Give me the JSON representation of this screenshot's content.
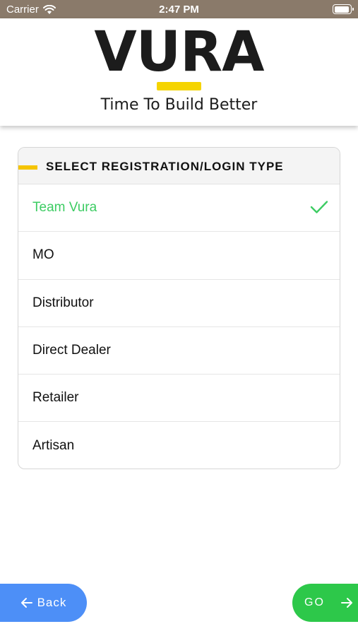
{
  "status_bar": {
    "carrier": "Carrier",
    "time": "2:47 PM"
  },
  "brand": {
    "logo_text": "VURA",
    "tagline": "Time To Build Better",
    "accent_color": "#f5d400"
  },
  "selection": {
    "title": "SELECT REGISTRATION/LOGIN TYPE",
    "options": [
      {
        "label": "Team Vura",
        "selected": true
      },
      {
        "label": "MO",
        "selected": false
      },
      {
        "label": "Distributor",
        "selected": false
      },
      {
        "label": "Direct Dealer",
        "selected": false
      },
      {
        "label": "Retailer",
        "selected": false
      },
      {
        "label": "Artisan",
        "selected": false
      }
    ],
    "selected_color": "#3dcc63"
  },
  "actions": {
    "back_label": "Back",
    "go_label": "GO",
    "back_color": "#4d8ff7",
    "go_color": "#2dc84a"
  }
}
